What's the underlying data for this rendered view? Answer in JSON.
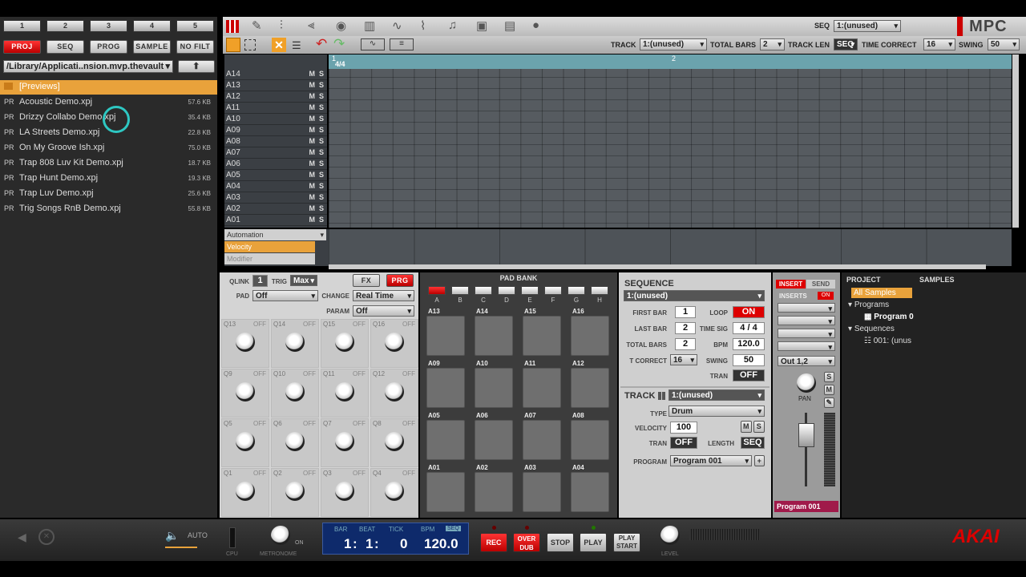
{
  "file_tabs": [
    "1",
    "2",
    "3",
    "4",
    "5"
  ],
  "modes": [
    "PROJ",
    "SEQ",
    "PROG",
    "SAMPLE",
    "NO FILT"
  ],
  "path": "/Library/Applicati..nsion.mvp.thevault",
  "folder": "[Previews]",
  "files": [
    {
      "t": "PR",
      "n": "Acoustic Demo.xpj",
      "s": "57.6 KB"
    },
    {
      "t": "PR",
      "n": "Drizzy Collabo Demo.xpj",
      "s": "35.4 KB"
    },
    {
      "t": "PR",
      "n": "LA Streets Demo.xpj",
      "s": "22.8 KB"
    },
    {
      "t": "PR",
      "n": "On My Groove Ish.xpj",
      "s": "75.0 KB"
    },
    {
      "t": "PR",
      "n": "Trap 808 Luv Kit Demo.xpj",
      "s": "18.7 KB"
    },
    {
      "t": "PR",
      "n": "Trap Hunt Demo.xpj",
      "s": "19.3 KB"
    },
    {
      "t": "PR",
      "n": "Trap Luv Demo.xpj",
      "s": "25.6 KB"
    },
    {
      "t": "PR",
      "n": "Trig Songs RnB Demo.xpj",
      "s": "55.8 KB"
    }
  ],
  "header": {
    "seq_label": "SEQ",
    "seq_value": "1:(unused)",
    "logo": "MPC"
  },
  "trackbar": {
    "track_label": "TRACK",
    "track_value": "1:(unused)",
    "total_bars_label": "TOTAL BARS",
    "total_bars": "2",
    "track_len_label": "TRACK LEN",
    "track_len": "SEQ",
    "time_correct_label": "TIME CORRECT",
    "time_correct": "16",
    "swing_label": "SWING",
    "swing": "50"
  },
  "ruler": {
    "timesig": "4/4",
    "bar1": "1",
    "bar2": "2"
  },
  "tracks": [
    "A14",
    "A13",
    "A12",
    "A11",
    "A10",
    "A09",
    "A08",
    "A07",
    "A06",
    "A05",
    "A04",
    "A03",
    "A02",
    "A01"
  ],
  "automation": {
    "label": "Automation",
    "items": [
      "Velocity",
      "Modifier"
    ]
  },
  "qlink": {
    "qlink_label": "QLINK",
    "qlink": "1",
    "trig_label": "TRIG",
    "trig": "Max",
    "fx": "FX",
    "prg": "PRG",
    "pad_label": "PAD",
    "pad": "Off",
    "change_label": "CHANGE",
    "change": "Real Time",
    "param_label": "PARAM",
    "param": "Off"
  },
  "knobs": [
    "Q13",
    "Q14",
    "Q15",
    "Q16",
    "Q9",
    "Q10",
    "Q11",
    "Q12",
    "Q5",
    "Q6",
    "Q7",
    "Q8",
    "Q1",
    "Q2",
    "Q3",
    "Q4"
  ],
  "off": "OFF",
  "padbank": {
    "title": "PAD BANK",
    "banks": [
      "A",
      "B",
      "C",
      "D",
      "E",
      "F",
      "G",
      "H"
    ]
  },
  "pads": [
    "A13",
    "A14",
    "A15",
    "A16",
    "A09",
    "A10",
    "A11",
    "A12",
    "A05",
    "A06",
    "A07",
    "A08",
    "A01",
    "A02",
    "A03",
    "A04"
  ],
  "sequence": {
    "title": "SEQUENCE",
    "value": "1:(unused)",
    "first_bar_label": "FIRST BAR",
    "first_bar": "1",
    "loop_label": "LOOP",
    "loop": "ON",
    "last_bar_label": "LAST BAR",
    "last_bar": "2",
    "timesig_label": "TIME SIG",
    "timesig": "4 / 4",
    "total_bars_label": "TOTAL BARS",
    "total_bars": "2",
    "bpm_label": "BPM",
    "bpm": "120.0",
    "tcorrect_label": "T CORRECT",
    "tcorrect": "16",
    "swing_label": "SWING",
    "swing": "50",
    "tran_label": "TRAN",
    "tran": "OFF"
  },
  "track": {
    "title": "TRACK",
    "value": "1:(unused)",
    "type_label": "TYPE",
    "type": "Drum",
    "velocity_label": "VELOCITY",
    "velocity": "100",
    "tran_label": "TRAN",
    "tran": "OFF",
    "length_label": "LENGTH",
    "length": "SEQ",
    "program_label": "PROGRAM",
    "program": "Program 001"
  },
  "mixer": {
    "insert": "INSERT",
    "send": "SEND",
    "inserts": "INSERTS",
    "on": "ON",
    "out": "Out 1,2",
    "pan": "PAN",
    "program": "Program 001"
  },
  "project": {
    "tab1": "PROJECT",
    "tab2": "SAMPLES",
    "all": "All Samples",
    "programs": "Programs",
    "program": "Program 0",
    "sequences": "Sequences",
    "seq": "001: (unus"
  },
  "transport": {
    "auto": "AUTO",
    "cpu": "CPU",
    "metronome": "METRONOME",
    "on": "ON",
    "bar_l": "BAR",
    "beat_l": "BEAT",
    "tick_l": "TICK",
    "bpm_l": "BPM",
    "seq_l": "SEQ",
    "bar": "1",
    "beat": "1",
    "tick": "0",
    "bpm": "120.0",
    "rec": "REC",
    "overdub": "OVER DUB",
    "stop": "STOP",
    "play": "PLAY",
    "playstart": "PLAY START",
    "level": "LEVEL",
    "brand": "AKAI"
  }
}
